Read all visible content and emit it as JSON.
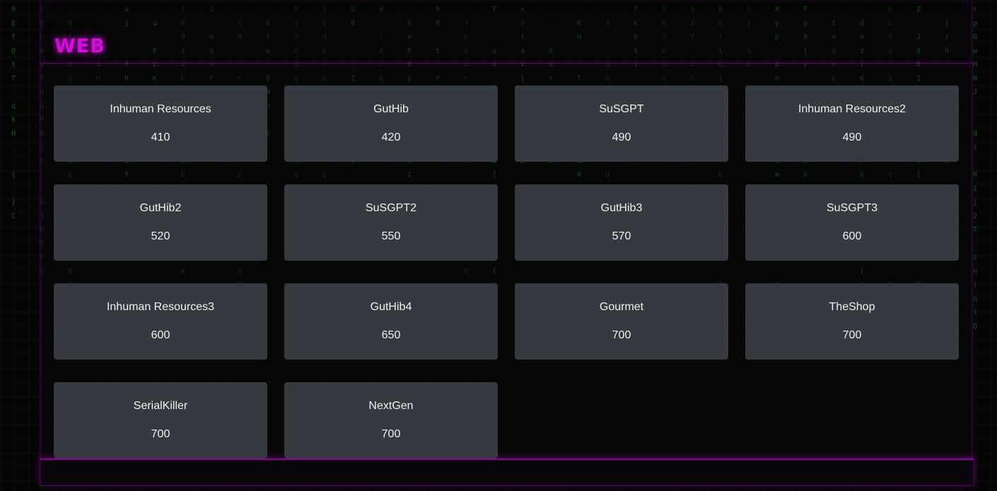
{
  "category": {
    "title": "WEB"
  },
  "theme": {
    "title_color": "#d010d8",
    "card_background": "#343a40",
    "card_text_color": "#f1f1f1",
    "background": "#050505",
    "matrix_color": "#1f8a2a"
  },
  "challenges": [
    {
      "name": "Inhuman Resources",
      "points": "410"
    },
    {
      "name": "GutHib",
      "points": "420"
    },
    {
      "name": "SuSGPT",
      "points": "490"
    },
    {
      "name": "Inhuman Resources2",
      "points": "490"
    },
    {
      "name": "GutHib2",
      "points": "520"
    },
    {
      "name": "SuSGPT2",
      "points": "550"
    },
    {
      "name": "GutHib3",
      "points": "570"
    },
    {
      "name": "SuSGPT3",
      "points": "600"
    },
    {
      "name": "Inhuman Resources3",
      "points": "600"
    },
    {
      "name": "GutHib4",
      "points": "650"
    },
    {
      "name": "Gourmet",
      "points": "700"
    },
    {
      "name": "TheShop",
      "points": "700"
    },
    {
      "name": "SerialKiller",
      "points": "700"
    },
    {
      "name": "NextGen",
      "points": "700"
    }
  ]
}
